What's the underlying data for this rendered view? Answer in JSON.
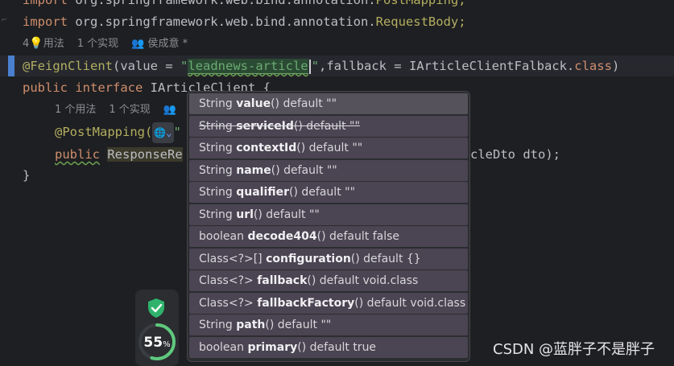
{
  "code": {
    "line_import1_kw": "import",
    "line_import1_text": " org.springframework.web.bind.annotation.",
    "line_import1_cls": "PostMapping;",
    "line_import2_kw": "import",
    "line_import2_text": " org.springframework.web.bind.annotation.",
    "line_import2_cls": "RequestBody;",
    "hint1_count": "4",
    "hint1_usages": "用法",
    "hint1_impl": "1 个实现",
    "hint1_author": "侯成意 *",
    "feign_ann": "@FeignClient",
    "feign_paren": "(value = ",
    "feign_quote_open": "\"",
    "feign_value": "leadnews-article",
    "feign_quote_close": "\"",
    "feign_rest": ",fallback = IArticleClientFalback.",
    "feign_class_kw": "class",
    "feign_close": ")",
    "iface_kw1": "public",
    "iface_kw2": "interface",
    "iface_name": " IArticleClient {",
    "hint2_usages": "1 个用法",
    "hint2_impl": "1 个实现",
    "post_ann": "@PostMapping(",
    "post_quote": "\"",
    "method_kw": "public",
    "method_type": "ResponseRe",
    "method_tail": "cleDto dto);",
    "close_brace": "}"
  },
  "popup": {
    "items": [
      {
        "type": "String",
        "name": "value",
        "suffix": "() default \"\""
      },
      {
        "type": "String",
        "name": "serviceId",
        "suffix": "() default \"\""
      },
      {
        "type": "String",
        "name": "contextId",
        "suffix": "() default \"\""
      },
      {
        "type": "String",
        "name": "name",
        "suffix": "() default \"\""
      },
      {
        "type": "String",
        "name": "qualifier",
        "suffix": "() default \"\""
      },
      {
        "type": "String",
        "name": "url",
        "suffix": "() default \"\""
      },
      {
        "type": "boolean",
        "name": "decode404",
        "suffix": "() default false"
      },
      {
        "type": "Class<?>[]",
        "name": "configuration",
        "suffix": "() default {}"
      },
      {
        "type": "Class<?>",
        "name": "fallback",
        "suffix": "() default void.class"
      },
      {
        "type": "Class<?>",
        "name": "fallbackFactory",
        "suffix": "() default void.class"
      },
      {
        "type": "String",
        "name": "path",
        "suffix": "() default \"\""
      },
      {
        "type": "boolean",
        "name": "primary",
        "suffix": "() default true"
      }
    ]
  },
  "widget": {
    "percent": "55",
    "percent_sign": "%",
    "progress": 0.55,
    "shield_color": "#2fb36c"
  },
  "watermark": "CSDN @蓝胖子不是胖子",
  "colors": {
    "keyword": "#cf8e6d",
    "string": "#6aab73",
    "annotation": "#b3ae60",
    "background": "#1e1f22",
    "popup_bg": "#2b2d30",
    "selected_item": "#55525b"
  }
}
